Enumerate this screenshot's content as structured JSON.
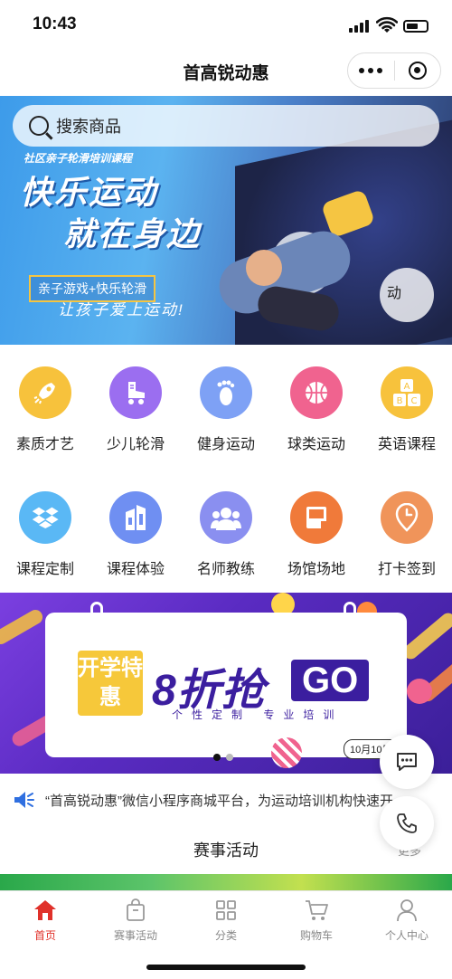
{
  "status": {
    "time": "10:43"
  },
  "header": {
    "title": "首高锐动惠"
  },
  "hero": {
    "search_placeholder": "搜索商品",
    "subtitle": "社区亲子轮滑培训课程",
    "headline1": "快乐运动",
    "headline2": "就在身边",
    "tag": "亲子游戏+快乐轮滑",
    "slogan": "让孩子爱上运动!",
    "logo_char": "动"
  },
  "categories_row1": [
    {
      "label": "素质才艺",
      "icon": "rocket-icon",
      "color": "#f7c23c"
    },
    {
      "label": "少儿轮滑",
      "icon": "roller-skate-icon",
      "color": "#9b6ef0"
    },
    {
      "label": "健身运动",
      "icon": "footprint-icon",
      "color": "#7ea1f5"
    },
    {
      "label": "球类运动",
      "icon": "ball-icon",
      "color": "#f0638f"
    },
    {
      "label": "英语课程",
      "icon": "abc-blocks-icon",
      "color": "#f7c23c"
    }
  ],
  "categories_row2": [
    {
      "label": "课程定制",
      "icon": "dropbox-icon",
      "color": "#5ab8f5"
    },
    {
      "label": "课程体验",
      "icon": "building-icon",
      "color": "#6f8ff2"
    },
    {
      "label": "名师教练",
      "icon": "people-icon",
      "color": "#8a8ff0"
    },
    {
      "label": "场馆场地",
      "icon": "venue-book-icon",
      "color": "#f07a3a"
    },
    {
      "label": "打卡签到",
      "icon": "location-pin-icon",
      "color": "#f0945a"
    }
  ],
  "promo": {
    "ribbon": "开学特惠",
    "big": "8折抢",
    "go": "GO",
    "small": "个性定制 专业培训",
    "date": "10月10日截"
  },
  "notice": {
    "text": "“首高锐动惠”微信小程序商城平台，为运动培训机构快速开..."
  },
  "section": {
    "title": "赛事活动",
    "more": "更多"
  },
  "tabbar": [
    {
      "label": "首页",
      "icon": "home-icon",
      "active": true
    },
    {
      "label": "赛事活动",
      "icon": "bag-icon",
      "active": false
    },
    {
      "label": "分类",
      "icon": "grid-icon",
      "active": false
    },
    {
      "label": "购物车",
      "icon": "cart-icon",
      "active": false
    },
    {
      "label": "个人中心",
      "icon": "user-icon",
      "active": false
    }
  ],
  "colors": {
    "accent": "#e0312a",
    "promo_purple": "#3b1e9f"
  }
}
